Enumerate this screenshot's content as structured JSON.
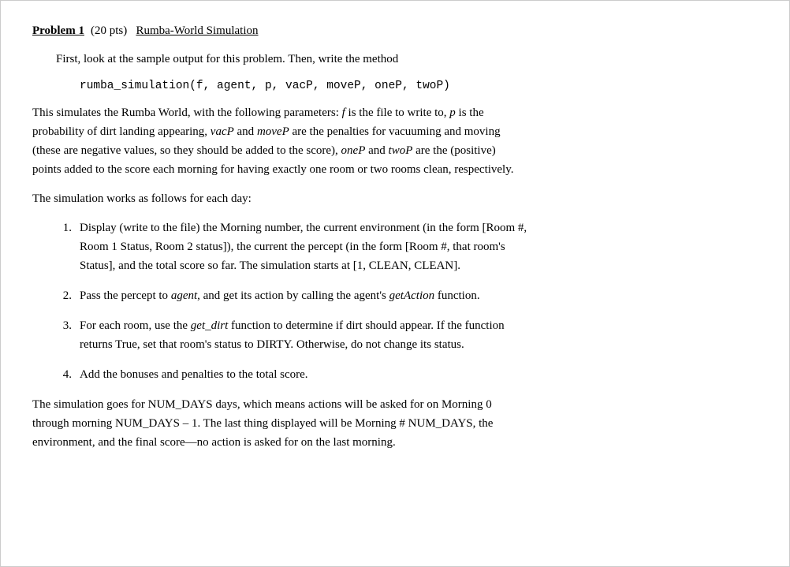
{
  "problem": {
    "title": "Problem 1",
    "points": "(20 pts)",
    "subtitle": "Rumba-World Simulation",
    "intro": "First, look at the sample output for this problem.  Then, write the method",
    "code": "rumba_simulation(f, agent, p, vacP, moveP, oneP, twoP)",
    "description_part1": "This simulates the Rumba World, with the following parameters: ",
    "f_param": "f",
    "desc_p1_mid": " is the file to write to, ",
    "p_param": "p",
    "desc_p1_end": " is the",
    "description_part2": "probability of dirt landing appearing, ",
    "vacP_param": "vacP",
    "desc_p2_mid": " and ",
    "moveP_param": "moveP",
    "desc_p2_end": " are the penalties for vacuuming and moving",
    "description_part3": "(these are negative values, so they should be added to the score),  ",
    "oneP_param": "oneP",
    "desc_p3_mid": " and ",
    "twoP_param": "twoP",
    "desc_p3_end": " are the (positive)",
    "description_part4": "points added to the score each morning for having exactly one room or two rooms clean, respectively.",
    "simulation_intro": "The simulation works as follows for each day:",
    "list_items": [
      {
        "number": "1.",
        "text_parts": [
          {
            "text": "Display (write to the file) the Morning number, the current environment (in the form [Room #,",
            "italic": false
          },
          {
            "text": "Room 1 Status, Room 2 status]), the current the percept (in the form [Room #, that room's",
            "italic": false
          },
          {
            "text": "Status], and the total score so far.  The simulation starts at  [1, CLEAN, CLEAN].",
            "italic": false
          }
        ]
      },
      {
        "number": "2.",
        "text_parts": [
          {
            "text": "Pass the percept to ",
            "italic": false
          },
          {
            "text": "agent",
            "italic": true
          },
          {
            "text": ", and get its action by calling the agent's ",
            "italic": false
          },
          {
            "text": "getAction",
            "italic": true
          },
          {
            "text": " function.",
            "italic": false
          }
        ]
      },
      {
        "number": "3.",
        "text_parts": [
          {
            "text": "For each room, use the ",
            "italic": false
          },
          {
            "text": "get_dirt",
            "italic": true
          },
          {
            "text": " function to determine if dirt should appear. If the function",
            "italic": false
          },
          {
            "newline": true
          },
          {
            "text": "returns True, set that room's status to DIRTY.  Otherwise, do not change its status.",
            "italic": false
          }
        ]
      },
      {
        "number": "4.",
        "text_parts": [
          {
            "text": "Add the bonuses and penalties to the total score.",
            "italic": false
          }
        ]
      }
    ],
    "footer": "The simulation goes for NUM_DAYS days, which means actions will be asked for on Morning 0\nthrough morning NUM_DAYS – 1.  The last thing displayed will be Morning # NUM_DAYS, the\nenvironment, and the final score—no action is asked for on the last morning."
  }
}
